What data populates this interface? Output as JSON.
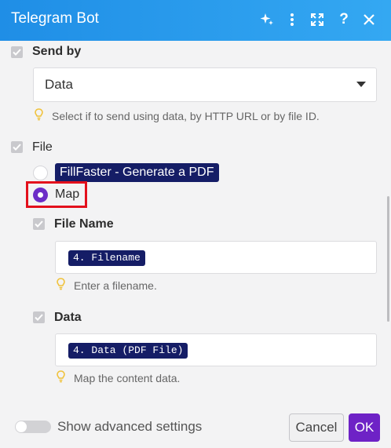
{
  "header": {
    "title": "Telegram Bot"
  },
  "send_by": {
    "label": "Send by",
    "value": "Data",
    "hint": "Select if to send using data, by HTTP URL or by file ID."
  },
  "file": {
    "label": "File",
    "options": [
      {
        "label": "FillFaster - Generate a PDF",
        "selected": false
      },
      {
        "label": "Map",
        "selected": true
      }
    ],
    "file_name": {
      "label": "File Name",
      "value": "4. Filename",
      "hint": "Enter a filename."
    },
    "data": {
      "label": "Data",
      "value": "4. Data (PDF File)",
      "hint": "Map the content data."
    }
  },
  "footer": {
    "advanced_label": "Show advanced settings",
    "cancel_label": "Cancel",
    "ok_label": "OK"
  },
  "colors": {
    "header_gradient_start": "#1f8ee6",
    "header_gradient_end": "#34a8f2",
    "accent": "#6e22c6",
    "pill": "#151d66",
    "highlight": "#e3101c"
  },
  "icons": [
    "ai-sparkle-icon",
    "more-vertical-icon",
    "expand-icon",
    "help-icon",
    "close-icon",
    "lightbulb-icon",
    "chevron-down-icon"
  ]
}
